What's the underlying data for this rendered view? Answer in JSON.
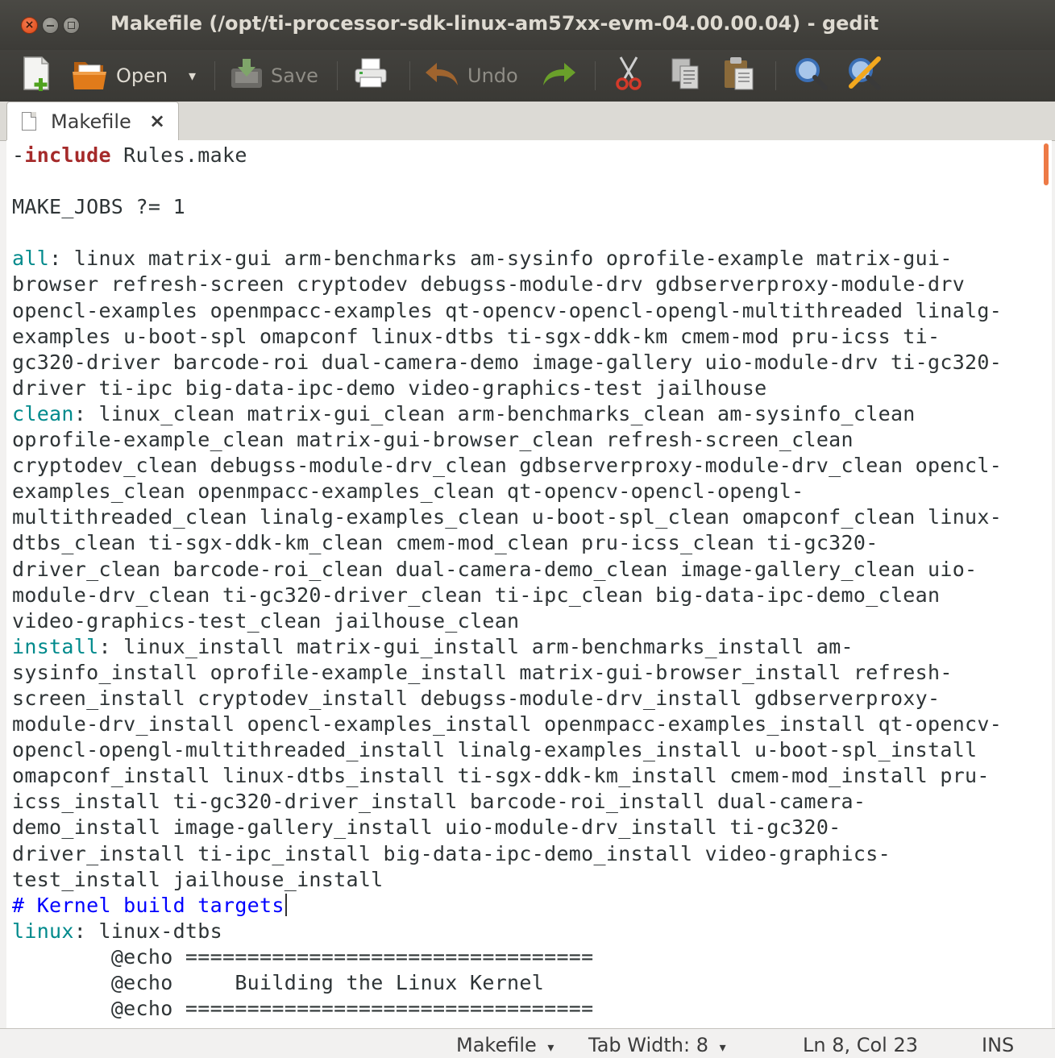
{
  "window": {
    "title": "Makefile (/opt/ti-processor-sdk-linux-am57xx-evm-04.00.00.04) - gedit"
  },
  "toolbar": {
    "new_icon": "document-new-icon",
    "open_label": "Open",
    "open_arrow": "▾",
    "save_label": "Save",
    "print_icon": "printer-icon",
    "undo_label": "Undo",
    "redo_icon": "redo-arrow-icon",
    "cut_icon": "scissors-icon",
    "copy_icon": "copy-icon",
    "paste_icon": "paste-icon",
    "find_icon": "magnifier-icon",
    "replace_icon": "find-replace-icon"
  },
  "tabs": [
    {
      "label": "Makefile",
      "close": "×"
    }
  ],
  "editor": {
    "lines": [
      [
        {
          "t": "-"
        },
        {
          "t": "include",
          "c": "kw"
        },
        {
          "t": " Rules.make"
        }
      ],
      [],
      [
        {
          "t": "MAKE_JOBS ?= 1"
        }
      ],
      [],
      [
        {
          "t": "all",
          "c": "tg"
        },
        {
          "t": ": linux matrix-gui arm-benchmarks am-sysinfo oprofile-example matrix-gui-"
        }
      ],
      [
        {
          "t": "browser refresh-screen cryptodev debugss-module-drv gdbserverproxy-module-drv"
        }
      ],
      [
        {
          "t": "opencl-examples openmpacc-examples qt-opencv-opencl-opengl-multithreaded linalg-"
        }
      ],
      [
        {
          "t": "examples u-boot-spl omapconf linux-dtbs ti-sgx-ddk-km cmem-mod pru-icss ti-"
        }
      ],
      [
        {
          "t": "gc320-driver barcode-roi dual-camera-demo image-gallery uio-module-drv ti-gc320-"
        }
      ],
      [
        {
          "t": "driver ti-ipc big-data-ipc-demo video-graphics-test jailhouse"
        }
      ],
      [
        {
          "t": "clean",
          "c": "tg"
        },
        {
          "t": ": linux_clean matrix-gui_clean arm-benchmarks_clean am-sysinfo_clean"
        }
      ],
      [
        {
          "t": "oprofile-example_clean matrix-gui-browser_clean refresh-screen_clean"
        }
      ],
      [
        {
          "t": "cryptodev_clean debugss-module-drv_clean gdbserverproxy-module-drv_clean opencl-"
        }
      ],
      [
        {
          "t": "examples_clean openmpacc-examples_clean qt-opencv-opencl-opengl-"
        }
      ],
      [
        {
          "t": "multithreaded_clean linalg-examples_clean u-boot-spl_clean omapconf_clean linux-"
        }
      ],
      [
        {
          "t": "dtbs_clean ti-sgx-ddk-km_clean cmem-mod_clean pru-icss_clean ti-gc320-"
        }
      ],
      [
        {
          "t": "driver_clean barcode-roi_clean dual-camera-demo_clean image-gallery_clean uio-"
        }
      ],
      [
        {
          "t": "module-drv_clean ti-gc320-driver_clean ti-ipc_clean big-data-ipc-demo_clean"
        }
      ],
      [
        {
          "t": "video-graphics-test_clean jailhouse_clean"
        }
      ],
      [
        {
          "t": "install",
          "c": "tg"
        },
        {
          "t": ": linux_install matrix-gui_install arm-benchmarks_install am-"
        }
      ],
      [
        {
          "t": "sysinfo_install oprofile-example_install matrix-gui-browser_install refresh-"
        }
      ],
      [
        {
          "t": "screen_install cryptodev_install debugss-module-drv_install gdbserverproxy-"
        }
      ],
      [
        {
          "t": "module-drv_install opencl-examples_install openmpacc-examples_install qt-opencv-"
        }
      ],
      [
        {
          "t": "opencl-opengl-multithreaded_install linalg-examples_install u-boot-spl_install"
        }
      ],
      [
        {
          "t": "omapconf_install linux-dtbs_install ti-sgx-ddk-km_install cmem-mod_install pru-"
        }
      ],
      [
        {
          "t": "icss_install ti-gc320-driver_install barcode-roi_install dual-camera-"
        }
      ],
      [
        {
          "t": "demo_install image-gallery_install uio-module-drv_install ti-gc320-"
        }
      ],
      [
        {
          "t": "driver_install ti-ipc_install big-data-ipc-demo_install video-graphics-"
        }
      ],
      [
        {
          "t": "test_install jailhouse_install"
        }
      ],
      [
        {
          "t": "# Kernel build targets",
          "c": "cm"
        },
        {
          "caret": true
        }
      ],
      [
        {
          "t": "linux",
          "c": "tg"
        },
        {
          "t": ": linux-dtbs"
        }
      ],
      [
        {
          "t": "\t@echo ================================="
        }
      ],
      [
        {
          "t": "\t@echo     Building the Linux Kernel"
        }
      ],
      [
        {
          "t": "\t@echo ================================="
        }
      ]
    ]
  },
  "statusbar": {
    "language": "Makefile",
    "language_arrow": "▾",
    "tab_width": "Tab Width: 8",
    "tab_width_arrow": "▾",
    "position": "Ln 8, Col 23",
    "mode": "INS"
  },
  "colors": {
    "titlebar": "#3c3b37",
    "keyword": "#a52a2a",
    "target": "#008a8c",
    "comment": "#0000ff",
    "scrollbar_accent": "#ed7a46"
  }
}
